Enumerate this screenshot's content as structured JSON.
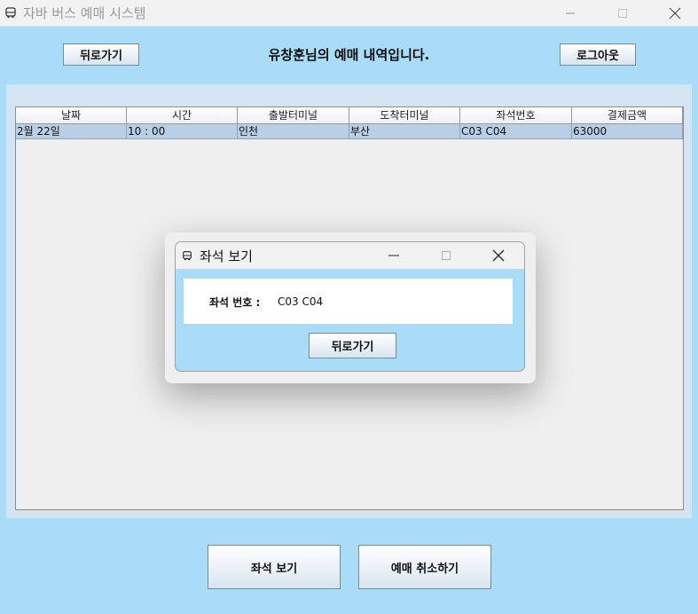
{
  "window": {
    "title": "자바 버스 예매 시스템",
    "app_icon": "bus-icon",
    "minimize_icon": "minimize-icon",
    "maximize_icon": "maximize-icon",
    "close_icon": "close-icon"
  },
  "header": {
    "back_label": "뒤로가기",
    "message": "유창훈님의 예매 내역입니다.",
    "logout_label": "로그아웃"
  },
  "table": {
    "columns": [
      "날짜",
      "시간",
      "출발터미널",
      "도착터미널",
      "좌석번호",
      "결제금액"
    ],
    "rows": [
      [
        "2월 22일",
        "10 : 00",
        "인천",
        "부산",
        "C03 C04",
        "63000"
      ]
    ],
    "selected_row_color": "#b8cfe5"
  },
  "dialog": {
    "title": "좌석 보기",
    "seat_label": "좌석 번호 :",
    "seat_value": "C03 C04",
    "back_label": "뒤로가기"
  },
  "footer": {
    "view_seat_label": "좌석 보기",
    "cancel_label": "예매 취소하기"
  },
  "colors": {
    "background": "#a8dcf7",
    "panel": "#d4e4f2"
  }
}
